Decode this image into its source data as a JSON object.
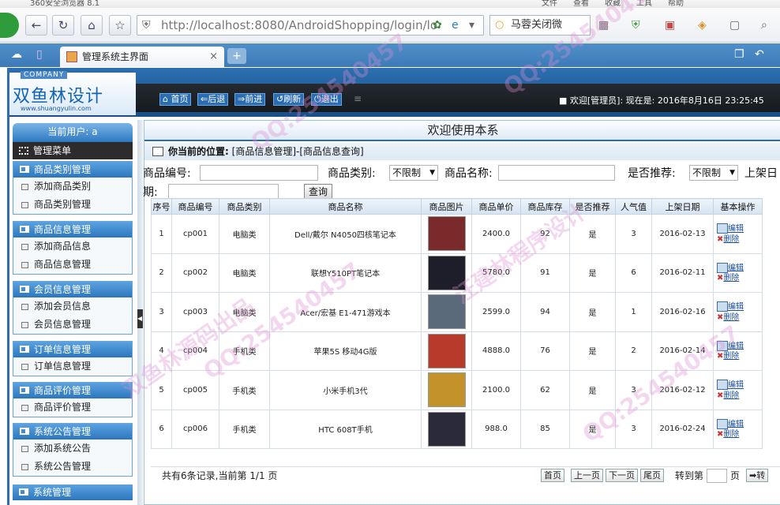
{
  "browser": {
    "title_left": "360安全浏览器 8.1",
    "title_menus": [
      "文件",
      "查看",
      "收藏",
      "工具",
      "帮助"
    ],
    "url_host": "http://localhost",
    "url_rest": ":8080/AndroidShopping/login/lo",
    "search_text": "马蓉关闭微",
    "tab_title": "管理系统主界面",
    "tab_close": "×",
    "new_tab": "+"
  },
  "header": {
    "company": "COMPANY",
    "logo_name": "双鱼林设计",
    "logo_url": "www.shuangyulin.com",
    "buttons": [
      "首页",
      "后退",
      "前进",
      "刷新",
      "退出"
    ],
    "welcome": "欢迎[管理员]:  现在是: 2016年8月16日 23:25:45"
  },
  "sidebar": {
    "current_user": "当前用户: a",
    "main_menu": "管理菜单",
    "sections": [
      {
        "title": "商品类别管理",
        "items": [
          "添加商品类别",
          "商品类别管理"
        ]
      },
      {
        "title": "商品信息管理",
        "items": [
          "添加商品信息",
          "商品信息管理"
        ]
      },
      {
        "title": "会员信息管理",
        "items": [
          "添加会员信息",
          "会员信息管理"
        ]
      },
      {
        "title": "订单信息管理",
        "items": [
          "订单信息管理"
        ]
      },
      {
        "title": "商品评价管理",
        "items": [
          "商品评价管理"
        ]
      },
      {
        "title": "系统公告管理",
        "items": [
          "添加系统公告",
          "系统公告管理"
        ]
      }
    ],
    "bottom": "系统管理"
  },
  "content": {
    "title": "欢迎使用本系",
    "crumb_label": "你当前的位置:",
    "crumb_path": "[商品信息管理]-[商品信息查询]",
    "filters": {
      "code_label": "商品编号:",
      "type_label": "商品类别:",
      "type_value": "不限制",
      "name_label": "商品名称:",
      "rec_label": "是否推荐:",
      "rec_value": "不限制",
      "date_label_1": "上架日",
      "date_label_2": "期:",
      "query": "查询"
    },
    "columns": [
      "序号",
      "商品编号",
      "商品类别",
      "商品名称",
      "商品图片",
      "商品单价",
      "商品库存",
      "是否推荐",
      "人气值",
      "上架日期",
      "基本操作"
    ],
    "rows": [
      {
        "no": "1",
        "code": "cp001",
        "type": "电脑类",
        "name": "Dell/戴尔 N4050四核笔记本",
        "price": "2400.0",
        "stock": "92",
        "rec": "是",
        "pop": "3",
        "date": "2016-02-13"
      },
      {
        "no": "2",
        "code": "cp002",
        "type": "电脑类",
        "name": "联想Y510PT笔记本",
        "price": "5780.0",
        "stock": "91",
        "rec": "是",
        "pop": "6",
        "date": "2016-02-11"
      },
      {
        "no": "3",
        "code": "cp003",
        "type": "电脑类",
        "name": "Acer/宏基 E1-471游戏本",
        "price": "2599.0",
        "stock": "94",
        "rec": "是",
        "pop": "1",
        "date": "2016-02-16"
      },
      {
        "no": "4",
        "code": "cp004",
        "type": "手机类",
        "name": "苹果5S 移动4G版",
        "price": "4888.0",
        "stock": "76",
        "rec": "是",
        "pop": "2",
        "date": "2016-02-14"
      },
      {
        "no": "5",
        "code": "cp005",
        "type": "手机类",
        "name": "小米手机3代",
        "price": "2100.0",
        "stock": "62",
        "rec": "是",
        "pop": "3",
        "date": "2016-02-12"
      },
      {
        "no": "6",
        "code": "cp006",
        "type": "手机类",
        "name": "HTC 608T手机",
        "price": "988.0",
        "stock": "85",
        "rec": "是",
        "pop": "3",
        "date": "2016-02-24"
      }
    ],
    "edit_label": "编辑",
    "delete_label": "删除",
    "pager": {
      "summary": "共有6条记录,当前第 1/1 页",
      "first": "首页",
      "prev": "上一页",
      "next": "下一页",
      "last": "尾页",
      "goto": "转到第",
      "page_unit": "页",
      "go": "转"
    }
  },
  "watermarks": [
    "QQ:254540457",
    "双鱼林源码出品",
    "汪建林程序设计"
  ]
}
